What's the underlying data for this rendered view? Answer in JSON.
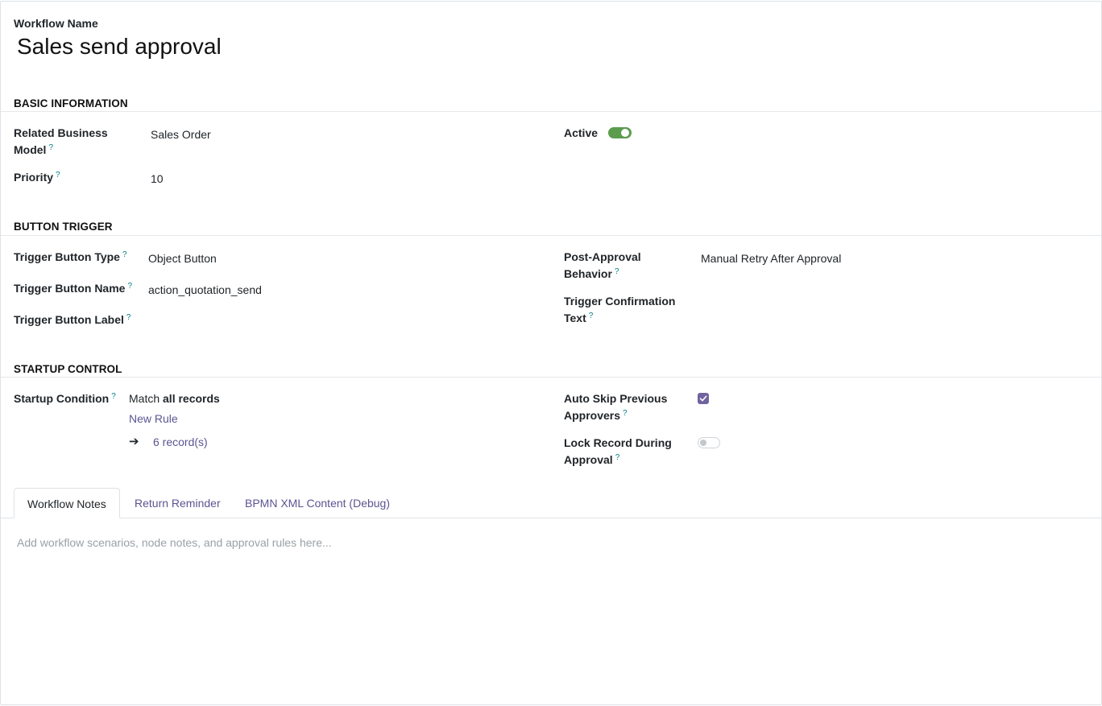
{
  "header": {
    "name_label": "Workflow Name",
    "name_value": "Sales send approval"
  },
  "help_mark": "?",
  "sections": {
    "basic": "BASIC INFORMATION",
    "trigger": "BUTTON TRIGGER",
    "startup": "STARTUP CONTROL"
  },
  "basic": {
    "related_model_label_line1": "Related Business",
    "related_model_label_line2": "Model",
    "related_model_value": "Sales Order",
    "priority_label": "Priority",
    "priority_value": "10",
    "active_label": "Active",
    "active_on": true
  },
  "trigger": {
    "type_label": "Trigger Button Type",
    "type_value": "Object Button",
    "name_label": "Trigger Button Name",
    "name_value": "action_quotation_send",
    "button_label_label": "Trigger Button Label",
    "post_label_line1": "Post-Approval",
    "post_label_line2": "Behavior",
    "post_value": "Manual Retry After Approval",
    "confirm_label_line1": "Trigger Confirmation",
    "confirm_label_line2": "Text"
  },
  "startup": {
    "condition_label": "Startup Condition",
    "match_prefix": "Match",
    "match_scope": "all records",
    "new_rule": "New Rule",
    "records_arrow": "➔",
    "records_count": "6 record(s)",
    "auto_skip_line1": "Auto Skip Previous",
    "auto_skip_line2": "Approvers",
    "auto_skip_checked": true,
    "lock_line1": "Lock Record During",
    "lock_line2": "Approval",
    "lock_on": false
  },
  "tabs": [
    {
      "label": "Workflow Notes",
      "active": true
    },
    {
      "label": "Return Reminder",
      "active": false
    },
    {
      "label": "BPMN XML Content (Debug)",
      "active": false
    }
  ],
  "notes": {
    "placeholder": "Add workflow scenarios, node notes, and approval rules here..."
  },
  "colors": {
    "accent": "#71639e",
    "link": "#5b5592",
    "toggle_on": "#5b9c4d",
    "help": "#017e84"
  }
}
